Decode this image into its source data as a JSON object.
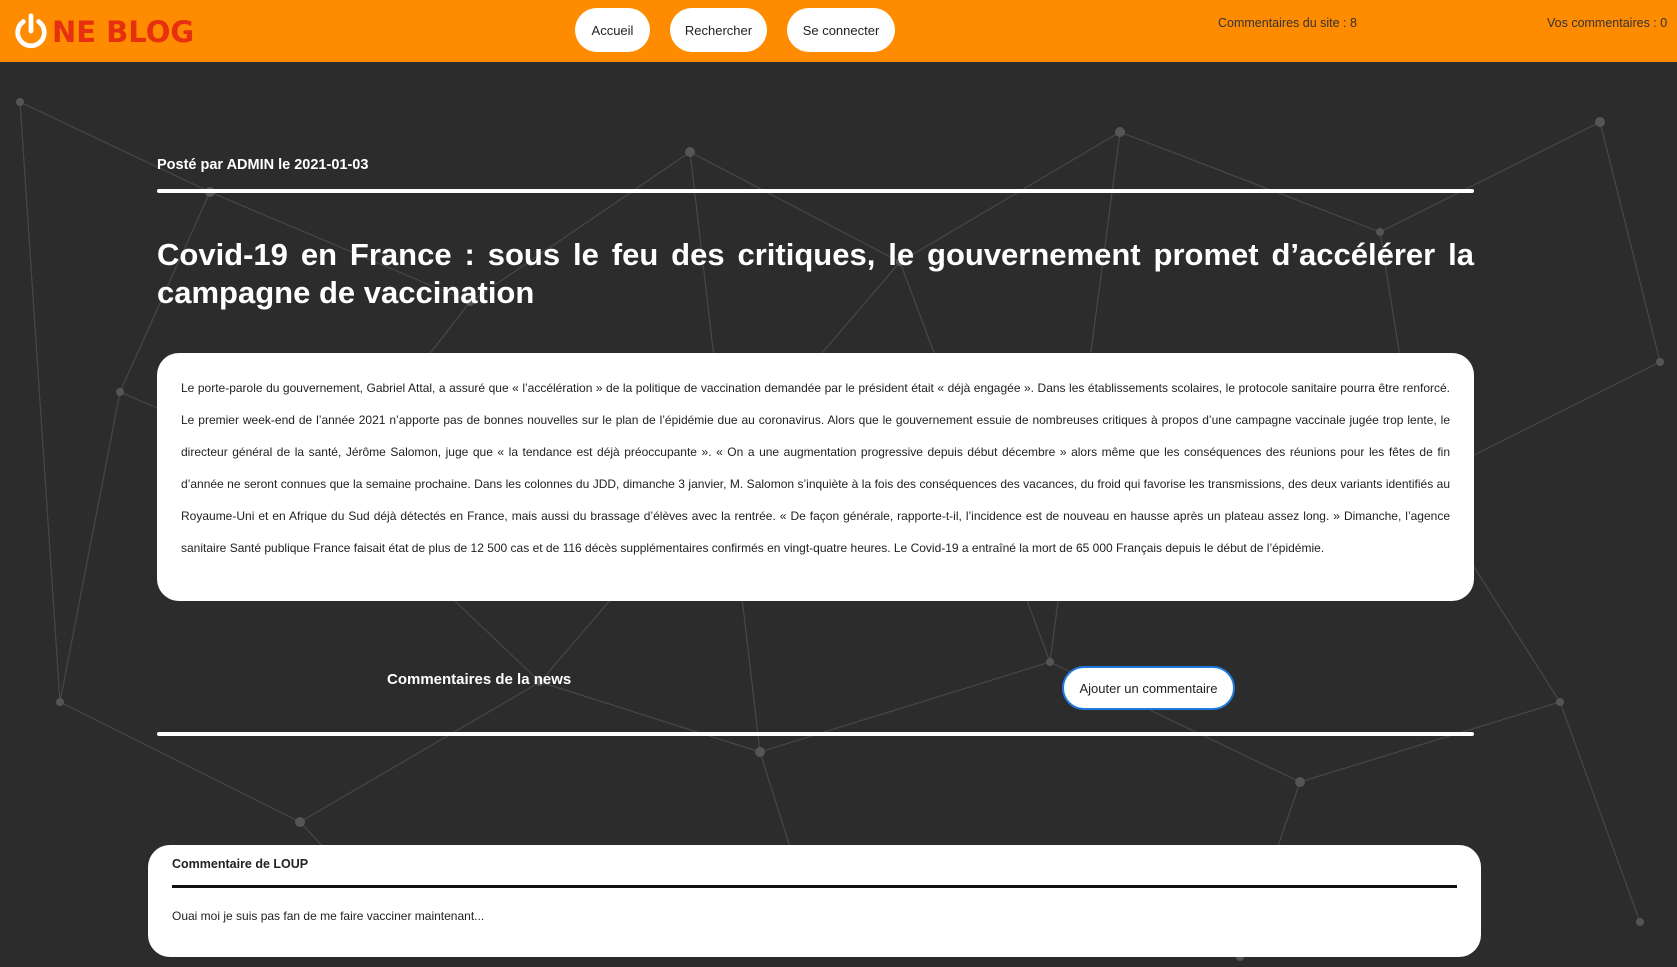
{
  "header": {
    "logo_text": "NE BLOG",
    "logo_icon": "power-icon",
    "nav": {
      "home": "Accueil",
      "search": "Rechercher",
      "login": "Se connecter"
    },
    "stats": {
      "site_comments": "Commentaires du site : 8",
      "my_comments": "Vos commentaires : 0"
    },
    "colors": {
      "bar": "#ff8b00",
      "logo": "#e7300f"
    }
  },
  "post": {
    "meta": "Posté par ADMIN le 2021-01-03",
    "title": "Covid-19 en France : sous le feu des critiques, le gouvernement promet d’accélérer la campagne de vaccination",
    "body": "Le porte-parole du gouvernement, Gabriel Attal, a assuré que « l’accélération » de la politique de vaccination demandée par le président était « déjà engagée ». Dans les établissements scolaires, le protocole sanitaire pourra être renforcé. Le premier week-end de l’année 2021 n’apporte pas de bonnes nouvelles sur le plan de l’épidémie due au coronavirus. Alors que le gouvernement essuie de nombreuses critiques à propos d’une campagne vaccinale jugée trop lente, le directeur général de la santé, Jérôme Salomon, juge que « la tendance est déjà préoccupante ». « On a une augmentation progressive depuis début décembre » alors même que les conséquences des réunions pour les fêtes de fin d’année ne seront connues que la semaine prochaine. Dans les colonnes du JDD, dimanche 3 janvier, M. Salomon s’inquiète à la fois des conséquences des vacances, du froid qui favorise les transmissions, des deux variants identifiés au Royaume-Uni et en Afrique du Sud déjà détectés en France, mais aussi du brassage d’élèves avec la rentrée. « De façon générale, rapporte-t-il, l’incidence est de nouveau en hausse après un plateau assez long. » Dimanche, l’agence sanitaire Santé publique France faisait état de plus de 12 500 cas et de 116 décès supplémentaires confirmés en vingt-quatre heures. Le Covid-19 a entraîné la mort de 65 000 Français depuis le début de l’épidémie."
  },
  "comments": {
    "section_title": "Commentaires de la news",
    "add_button": "Ajouter un commentaire",
    "items": [
      {
        "author": "Commentaire de LOUP",
        "text": "Ouai moi je suis pas fan de me faire vacciner maintenant..."
      }
    ]
  }
}
